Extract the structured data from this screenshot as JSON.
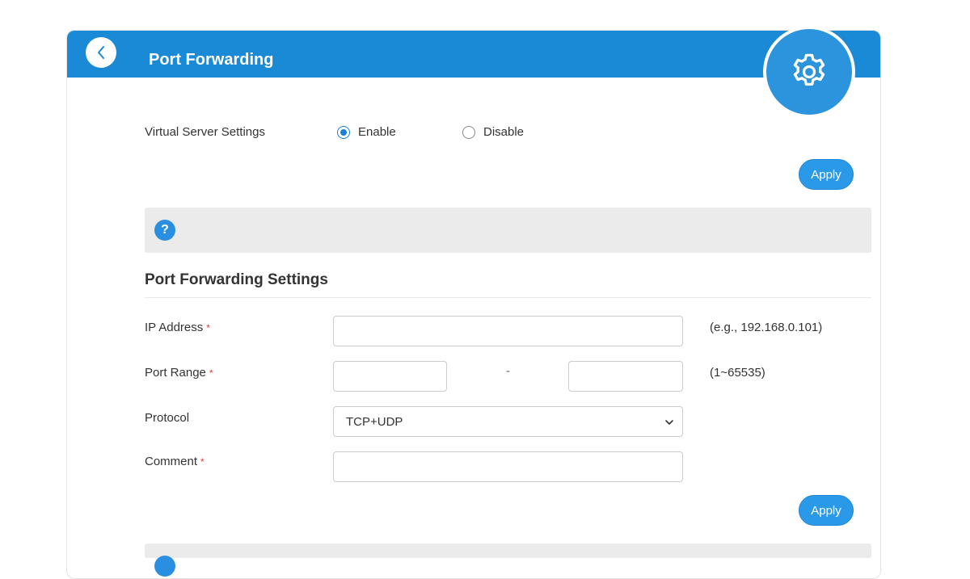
{
  "header": {
    "title": "Port Forwarding",
    "accent_color": "#1a8ad6",
    "back_icon": "chevron-left-icon",
    "gear_icon": "gear-icon"
  },
  "virtual_server": {
    "label": "Virtual Server Settings",
    "options": [
      {
        "label": "Enable",
        "checked": true
      },
      {
        "label": "Disable",
        "checked": false
      }
    ],
    "apply_label": "Apply"
  },
  "help": {
    "icon_glyph": "?"
  },
  "port_forwarding": {
    "section_title": "Port Forwarding Settings",
    "required_mark": "*",
    "fields": {
      "ip_address": {
        "label": "IP Address",
        "value": "",
        "hint": "(e.g., 192.168.0.101)"
      },
      "port_range": {
        "label": "Port Range",
        "start": "",
        "end": "",
        "separator": "-",
        "hint": "(1~65535)"
      },
      "protocol": {
        "label": "Protocol",
        "selected": "TCP+UDP"
      },
      "comment": {
        "label": "Comment",
        "value": ""
      }
    },
    "apply_label": "Apply"
  }
}
